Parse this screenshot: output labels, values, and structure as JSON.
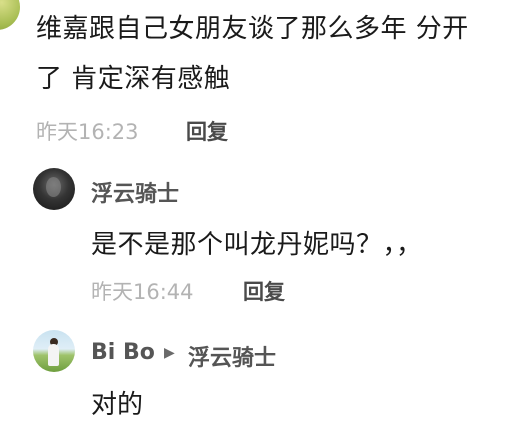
{
  "main_comment": {
    "text_line_1": "维嘉跟自己女朋友谈了那么多年 分开",
    "text_line_2": "了 肯定深有感触",
    "time": "昨天16:23",
    "reply_label": "回复"
  },
  "replies": [
    {
      "author": "浮云骑士",
      "text": "是不是那个叫龙丹妮吗？，，",
      "time": "昨天16:44",
      "reply_label": "回复"
    },
    {
      "author": "Bi Bo",
      "arrow_icon": "triangle-right-icon",
      "reply_to": "浮云骑士",
      "text": "对的"
    }
  ],
  "colors": {
    "text": "#1a1a1a",
    "username": "#555555",
    "timestamp": "#b3b3b3",
    "reply_button": "#4a4a4a"
  }
}
